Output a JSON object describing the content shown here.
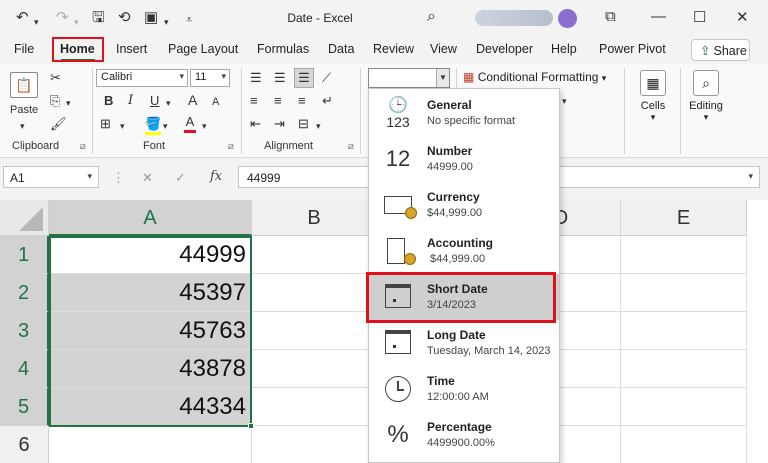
{
  "window": {
    "title": "Date  -  Excel",
    "quick_access": [
      "undo-icon",
      "redo-icon",
      "save-icon",
      "autosave-icon",
      "sheet-icon",
      "dropdown-icon"
    ],
    "controls": [
      "ribbon-display-icon",
      "minimize-icon",
      "maximize-icon",
      "close-icon"
    ]
  },
  "menu": {
    "tabs": [
      "File",
      "Home",
      "Insert",
      "Page Layout",
      "Formulas",
      "Data",
      "Review",
      "View",
      "Developer",
      "Help",
      "Power Pivot"
    ],
    "active_tab": "Home",
    "share_label": "Share",
    "accent_color": "#217346",
    "highlight_color": "#e0111c"
  },
  "ribbon": {
    "clipboard": {
      "paste_label": "Paste",
      "group_label": "Clipboard"
    },
    "font": {
      "font_name": "Calibri",
      "font_size": "11",
      "bold": "B",
      "italic": "I",
      "underline": "U",
      "grow": "A",
      "shrink": "A",
      "font_color": "A",
      "group_label": "Font"
    },
    "alignment": {
      "group_label": "Alignment"
    },
    "number": {
      "format_value": ""
    },
    "styles": {
      "conditional_formatting": "Conditional Formatting"
    },
    "cells_label": "Cells",
    "editing_label": "Editing"
  },
  "formula_bar": {
    "name_box": "A1",
    "fx": "fx",
    "value": "44999"
  },
  "grid": {
    "columns": [
      "A",
      "B",
      "C",
      "D",
      "E"
    ],
    "rows": [
      "1",
      "2",
      "3",
      "4",
      "5",
      "6"
    ],
    "selected_column": "A",
    "values": [
      "44999",
      "45397",
      "45763",
      "43878",
      "44334"
    ]
  },
  "number_format_menu": {
    "selected": "Short Date",
    "options": [
      {
        "name": "General",
        "sample": "No specific format",
        "icon": "general-123-icon"
      },
      {
        "name": "Number",
        "sample": "44999.00",
        "icon": "number-12-icon",
        "glyph": "12"
      },
      {
        "name": "Currency",
        "sample": "$44,999.00",
        "icon": "currency-icon"
      },
      {
        "name": "Accounting",
        "sample": " $44,999.00",
        "icon": "accounting-icon"
      },
      {
        "name": "Short Date",
        "sample": "3/14/2023",
        "icon": "calendar-icon"
      },
      {
        "name": "Long Date",
        "sample": "Tuesday, March 14, 2023",
        "icon": "calendar-icon"
      },
      {
        "name": "Time",
        "sample": "12:00:00 AM",
        "icon": "clock-icon"
      },
      {
        "name": "Percentage",
        "sample": "4499900.00%",
        "icon": "percent-icon",
        "glyph": "%"
      }
    ]
  }
}
